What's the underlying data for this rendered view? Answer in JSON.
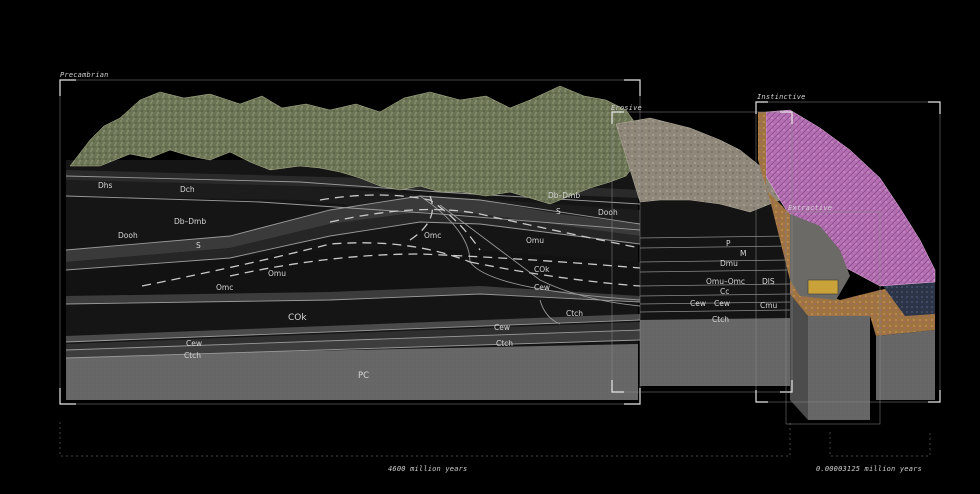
{
  "sections": {
    "precambrian": "Precambrian",
    "erosive": "Erosive",
    "instinctive": "Instinctive",
    "extractive": "Extractive"
  },
  "timescales": {
    "left": "4600 million years",
    "right": "0.00003125 million years"
  },
  "units": {
    "dhs": "Dhs",
    "dch": "Dch",
    "db_dmb": "Db–Dmb",
    "db_dmb_right": "Db–Dmb",
    "dooh": "Dooh",
    "dooh_right": "Dooh",
    "s_left": "S",
    "s_right": "S",
    "omc_upper": "Omc",
    "omc_lower": "Omc",
    "omu": "Omu",
    "omu_right": "Omu",
    "cok_right": "COk",
    "cok_main": "COk",
    "cew_right": "Cew",
    "cew_mid": "Cew",
    "cew_bottom": "Cew",
    "ctch_right": "Ctch",
    "ctch_mid": "Ctch",
    "ctch_bottom": "Ctch",
    "pc": "PC",
    "p": "P",
    "m": "M",
    "dmu": "Dmu",
    "omu_omc": "Omu–Omc",
    "cc": "Cc",
    "dls": "DlS",
    "cmu": "Cmu"
  },
  "colors": {
    "background": "#000000",
    "frame": "#e8e8e8",
    "strata_dark": "#151515",
    "strata_mid": "#2b2b2b",
    "pc_gray": "#6a6a6a",
    "terrain_green": "#6b7455",
    "terrain_tan": "#8f887a",
    "instinctive_pink": "#b36fb2",
    "extractive_ochre": "#9e7440"
  }
}
